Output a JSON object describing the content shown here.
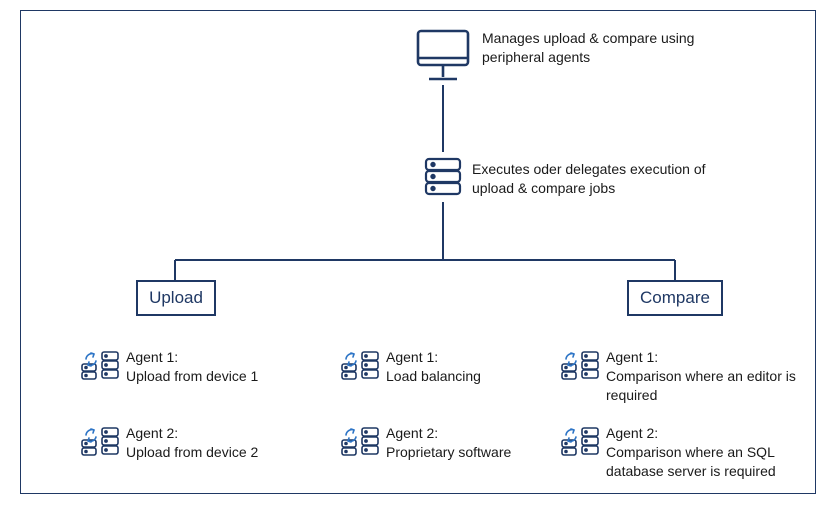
{
  "colors": {
    "line": "#1f3864",
    "accent": "#2e75c6"
  },
  "top": {
    "monitor_caption": "Manages upload & compare using peripheral agents",
    "server_caption": "Executes oder delegates execution of upload & compare jobs"
  },
  "nodes": {
    "upload": "Upload",
    "compare": "Compare"
  },
  "agents": {
    "upload": [
      {
        "title": "Agent 1:",
        "desc": "Upload from device 1"
      },
      {
        "title": "Agent 2:",
        "desc": "Upload from device 2"
      }
    ],
    "center": [
      {
        "title": "Agent 1:",
        "desc": "Load balancing"
      },
      {
        "title": "Agent 2:",
        "desc": "Proprietary software"
      }
    ],
    "compare": [
      {
        "title": "Agent 1:",
        "desc": "Comparison where an editor is required"
      },
      {
        "title": "Agent 2:",
        "desc": "Comparison where an SQL database server is required"
      }
    ]
  }
}
